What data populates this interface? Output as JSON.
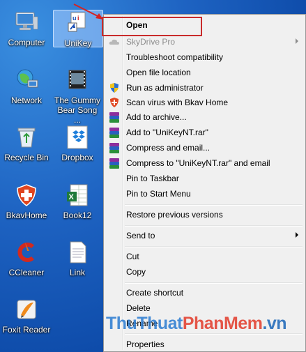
{
  "desktop": {
    "icons": [
      {
        "label": "Computer"
      },
      {
        "label": "UniKey"
      },
      {
        "label": "Network"
      },
      {
        "label_line1": "The Gummy",
        "label_line2": "Bear Song ..."
      },
      {
        "label": "Recycle Bin"
      },
      {
        "label": "Dropbox"
      },
      {
        "label": "BkavHome"
      },
      {
        "label": "Book12"
      },
      {
        "label": "CCleaner"
      },
      {
        "label": "Link"
      },
      {
        "label": "Foxit Reader"
      }
    ]
  },
  "context_menu": {
    "items": [
      {
        "label": "Open"
      },
      {
        "label": "SkyDrive Pro"
      },
      {
        "label": "Troubleshoot compatibility"
      },
      {
        "label": "Open file location"
      },
      {
        "label": "Run as administrator"
      },
      {
        "label": "Scan virus with Bkav Home"
      },
      {
        "label": "Add to archive..."
      },
      {
        "label": "Add to \"UniKeyNT.rar\""
      },
      {
        "label": "Compress and email..."
      },
      {
        "label": "Compress to \"UniKeyNT.rar\" and email"
      },
      {
        "label": "Pin to Taskbar"
      },
      {
        "label": "Pin to Start Menu"
      },
      {
        "label": "Restore previous versions"
      },
      {
        "label": "Send to"
      },
      {
        "label": "Cut"
      },
      {
        "label": "Copy"
      },
      {
        "label": "Create shortcut"
      },
      {
        "label": "Delete"
      },
      {
        "label": "Rename"
      },
      {
        "label": "Properties"
      }
    ]
  },
  "watermark": {
    "part1": "ThuThuat",
    "part2": "PhanMem",
    "part3": ".vn"
  },
  "colors": {
    "highlight": "#c92b2b",
    "desktop": "#1e63c2",
    "menu_bg": "#f0f0f0"
  }
}
